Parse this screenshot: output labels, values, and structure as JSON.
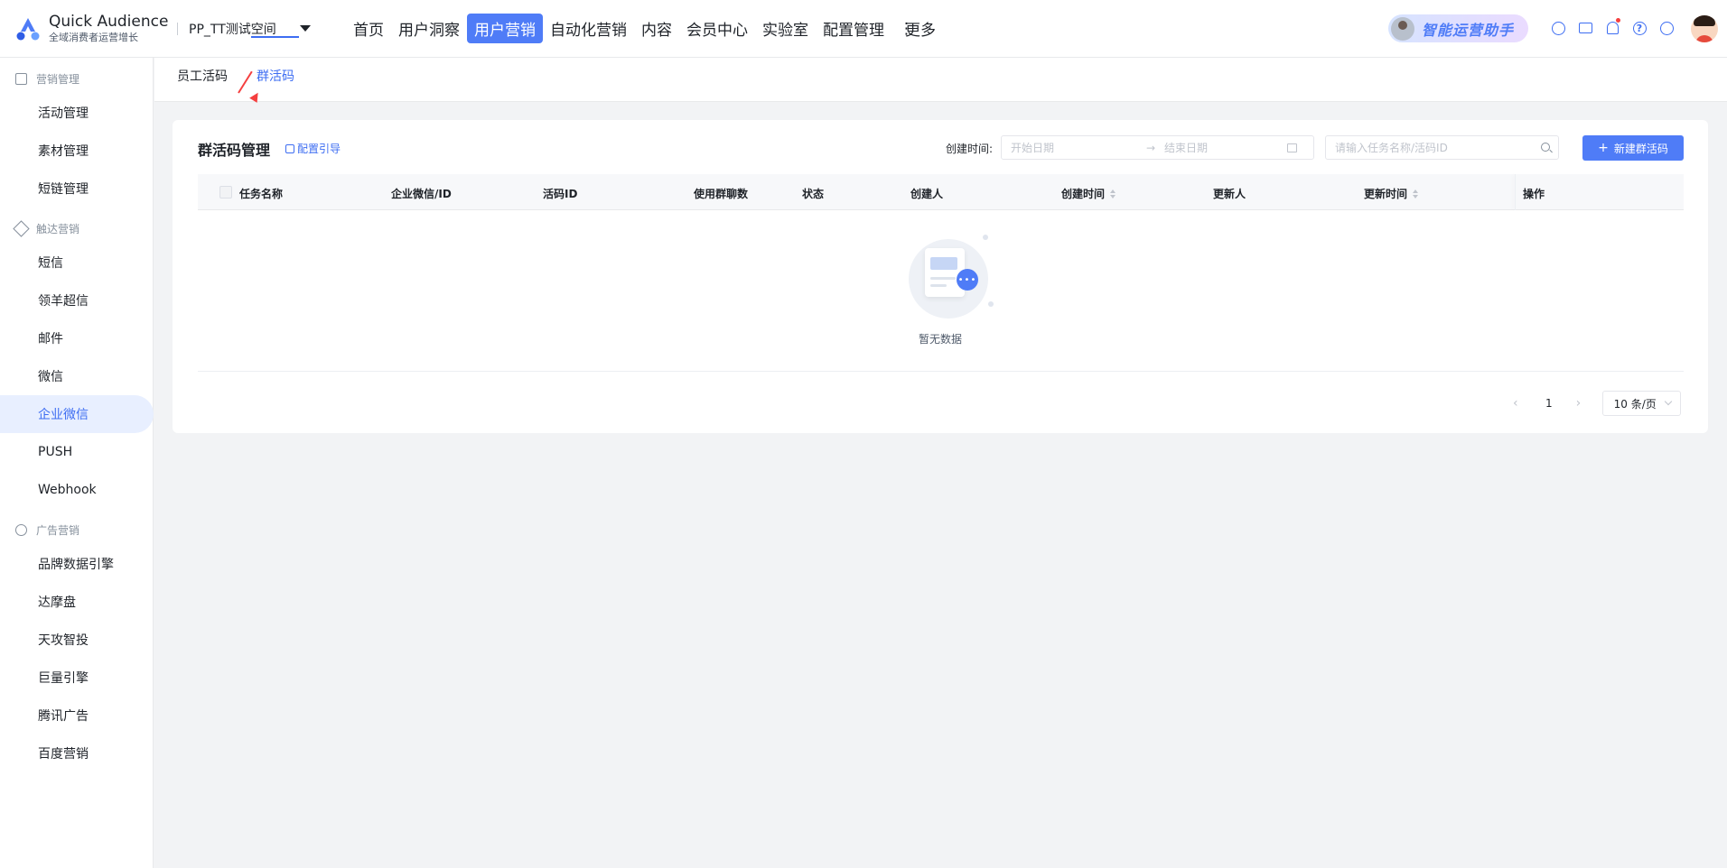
{
  "app": {
    "title": "Quick Audience",
    "subtitle": "全域消费者运营增长",
    "workspace": "PP_TT测试空间"
  },
  "nav": {
    "items": [
      "首页",
      "用户洞察",
      "用户营销",
      "自动化营销",
      "内容",
      "会员中心",
      "实验室",
      "配置管理"
    ],
    "active": "用户营销",
    "more": "更多"
  },
  "assistant": {
    "label": "智能运营助手"
  },
  "header_icons": [
    "settings-icon",
    "briefcase-icon",
    "bell-icon",
    "help-icon",
    "globe-icon"
  ],
  "sidebar": {
    "groups": [
      {
        "label": "营销管理",
        "icon": "layers-icon",
        "items": [
          "活动管理",
          "素材管理",
          "短链管理"
        ]
      },
      {
        "label": "触达营销",
        "icon": "send-icon",
        "items": [
          "短信",
          "领羊超信",
          "邮件",
          "微信",
          "企业微信",
          "PUSH",
          "Webhook"
        ]
      },
      {
        "label": "广告营销",
        "icon": "share-icon",
        "items": [
          "品牌数据引擎",
          "达摩盘",
          "天攻智投",
          "巨量引擎",
          "腾讯广告",
          "百度营销"
        ]
      }
    ],
    "active": "企业微信"
  },
  "tabs": {
    "items": [
      "员工活码",
      "群活码"
    ],
    "active": "群活码"
  },
  "panel": {
    "title": "群活码管理",
    "guide": "配置引导",
    "date_label": "创建时间:",
    "date_start_placeholder": "开始日期",
    "date_sep": "→",
    "date_end_placeholder": "结束日期",
    "search_placeholder": "请输入任务名称/活码ID",
    "new_button": "新建群活码",
    "columns": [
      "任务名称",
      "企业微信/ID",
      "活码ID",
      "使用群聊数",
      "状态",
      "创建人",
      "创建时间",
      "更新人",
      "更新时间",
      "操作"
    ],
    "empty_text": "暂无数据",
    "pagination": {
      "page": "1",
      "page_size": "10 条/页"
    }
  },
  "colors": {
    "accent": "#4f7cf7",
    "active_bg": "#e8efff",
    "annotation_arrow": "#f53f3f"
  }
}
